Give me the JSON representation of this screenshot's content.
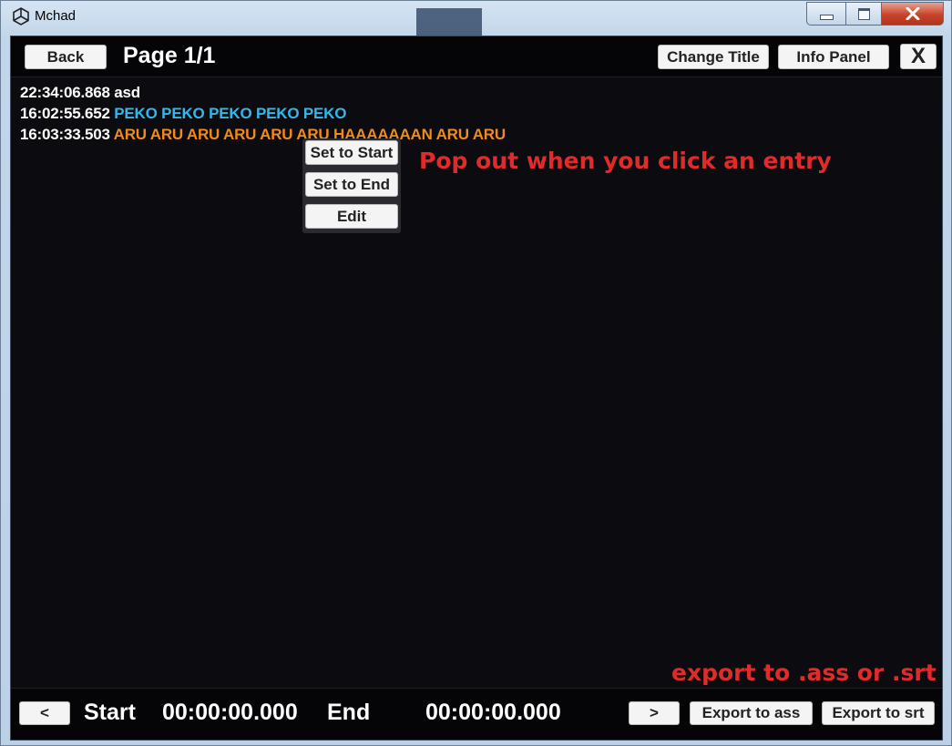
{
  "window": {
    "title": "Mchad",
    "app_icon": "unity-icon"
  },
  "window_controls": {
    "minimize": "minimize-icon",
    "maximize": "maximize-icon",
    "close": "close-icon"
  },
  "header": {
    "back_label": "Back",
    "page_label": "Page 1/1",
    "change_title_label": "Change Title",
    "info_panel_label": "Info Panel",
    "close_label": "X"
  },
  "entries": [
    {
      "time": "22:34:06.868",
      "text": "asd",
      "color": "#ffffff"
    },
    {
      "time": "16:02:55.652",
      "text": "PEKO PEKO PEKO PEKO PEKO",
      "color": "#36b7e8"
    },
    {
      "time": "16:03:33.503",
      "text": "ARU ARU ARU ARU ARU ARU HAAAAAAAN ARU ARU",
      "color": "#ef8a1c"
    }
  ],
  "popup": {
    "set_start_label": "Set to Start",
    "set_end_label": "Set to End",
    "edit_label": "Edit"
  },
  "annotations": {
    "popup_note": "Pop out when you click an entry",
    "export_note": "export to .ass or .srt",
    "color": "#e02b2b"
  },
  "footer": {
    "prev_label": "<",
    "start_label": "Start",
    "start_time": "00:00:00.000",
    "end_label": "End",
    "end_time": "00:00:00.000",
    "next_label": ">",
    "export_ass_label": "Export to ass",
    "export_srt_label": "Export to srt"
  }
}
